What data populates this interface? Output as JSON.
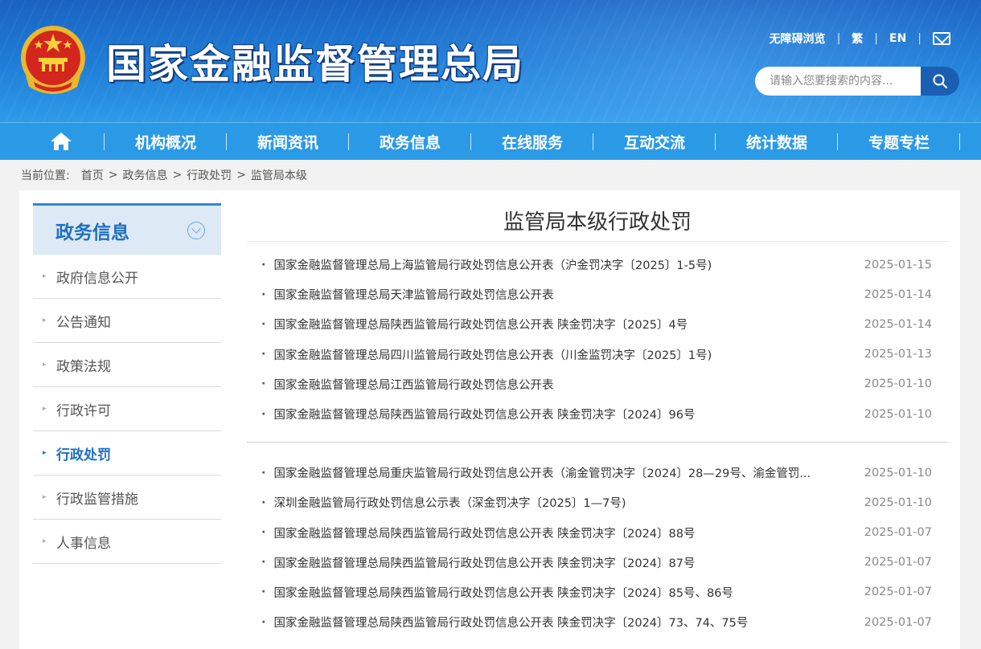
{
  "header": {
    "site_title": "国家金融监督管理总局",
    "top_links": [
      "无障碍浏览",
      "繁",
      "EN"
    ],
    "search_placeholder": "请输入您要搜索的内容..."
  },
  "nav": {
    "items": [
      "机构概况",
      "新闻资讯",
      "政务信息",
      "在线服务",
      "互动交流",
      "统计数据",
      "专题专栏"
    ]
  },
  "breadcrumb": {
    "label": "当前位置:",
    "items": [
      "首页",
      "政务信息",
      "行政处罚",
      "监管局本级"
    ]
  },
  "sidebar": {
    "title": "政务信息",
    "items": [
      {
        "label": "政府信息公开"
      },
      {
        "label": "公告通知"
      },
      {
        "label": "政策法规"
      },
      {
        "label": "行政许可"
      },
      {
        "label": "行政处罚"
      },
      {
        "label": "行政监管措施"
      },
      {
        "label": "人事信息"
      }
    ],
    "active_item": "行政处罚"
  },
  "content": {
    "title": "监管局本级行政处罚",
    "groups": [
      [
        {
          "text": "国家金融监督管理总局上海监管局行政处罚信息公开表（沪金罚决字〔2025〕1-5号)",
          "date": "2025-01-15"
        },
        {
          "text": "国家金融监督管理总局天津监管局行政处罚信息公开表",
          "date": "2025-01-14"
        },
        {
          "text": "国家金融监督管理总局陕西监管局行政处罚信息公开表 陕金罚决字〔2025〕4号",
          "date": "2025-01-14"
        },
        {
          "text": "国家金融监督管理总局四川监管局行政处罚信息公开表（川金监罚决字〔2025〕1号)",
          "date": "2025-01-13"
        },
        {
          "text": "国家金融监督管理总局江西监管局行政处罚信息公开表",
          "date": "2025-01-10"
        },
        {
          "text": "国家金融监督管理总局陕西监管局行政处罚信息公开表 陕金罚决字〔2024〕96号",
          "date": "2025-01-10"
        }
      ],
      [
        {
          "text": "国家金融监督管理总局重庆监管局行政处罚信息公开表（渝金管罚决字〔2024〕28—29号、渝金管罚...",
          "date": "2025-01-10"
        },
        {
          "text": "深圳金融监管局行政处罚信息公示表（深金罚决字〔2025〕1—7号)",
          "date": "2025-01-10"
        },
        {
          "text": "国家金融监督管理总局陕西监管局行政处罚信息公开表 陕金罚决字〔2024〕88号",
          "date": "2025-01-07"
        },
        {
          "text": "国家金融监督管理总局陕西监管局行政处罚信息公开表 陕金罚决字〔2024〕87号",
          "date": "2025-01-07"
        },
        {
          "text": "国家金融监督管理总局陕西监管局行政处罚信息公开表 陕金罚决字〔2024〕85号、86号",
          "date": "2025-01-07"
        },
        {
          "text": "国家金融监督管理总局陕西监管局行政处罚信息公开表 陕金罚决字〔2024〕73、74、75号",
          "date": "2025-01-07"
        }
      ]
    ]
  },
  "colors": {
    "header_blue": "#1f7fd8",
    "nav_blue": "#2a9ae6",
    "accent": "#1e6fc1"
  }
}
